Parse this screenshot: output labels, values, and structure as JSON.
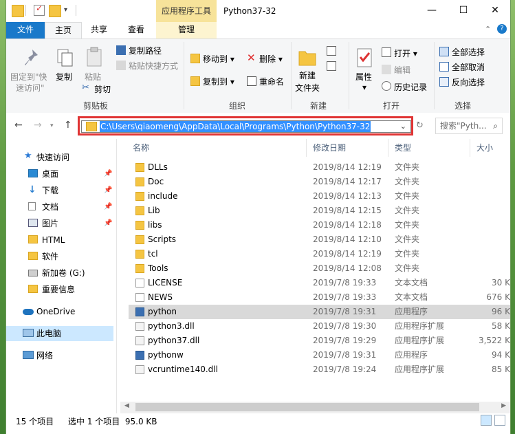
{
  "window": {
    "title": "Python37-32",
    "contextual_tab_group": "应用程序工具",
    "controls": {
      "minimize": "—",
      "maximize": "☐",
      "close": "✕"
    }
  },
  "ribbon_tabs": [
    {
      "label": "文件"
    },
    {
      "label": "主页"
    },
    {
      "label": "共享"
    },
    {
      "label": "查看"
    },
    {
      "label": "管理"
    }
  ],
  "ribbon": {
    "clipboard": {
      "pin_label_1": "固定到\"快",
      "pin_label_2": "速访问\"",
      "copy": "复制",
      "paste": "粘贴",
      "copy_path": "复制路径",
      "paste_shortcut": "粘贴快捷方式",
      "cut": "剪切",
      "group": "剪贴板"
    },
    "organize": {
      "move_to": "移动到",
      "copy_to": "复制到",
      "delete": "删除",
      "rename": "重命名",
      "group": "组织"
    },
    "new": {
      "new_folder_1": "新建",
      "new_folder_2": "文件夹",
      "group": "新建"
    },
    "open": {
      "properties": "属性",
      "open": "打开",
      "edit": "编辑",
      "history": "历史记录",
      "group": "打开"
    },
    "select": {
      "select_all": "全部选择",
      "select_none": "全部取消",
      "invert": "反向选择",
      "group": "选择"
    }
  },
  "address": {
    "path": "C:\\Users\\qiaomeng\\AppData\\Local\\Programs\\Python\\Python37-32",
    "search_placeholder": "搜索\"Pyth..."
  },
  "nav": {
    "items": [
      {
        "label": "快速访问",
        "icon": "star-icon",
        "pinned": false
      },
      {
        "label": "桌面",
        "icon": "desktop-icon",
        "pinned": true
      },
      {
        "label": "下载",
        "icon": "download-icon",
        "pinned": true
      },
      {
        "label": "文档",
        "icon": "document-icon",
        "pinned": true
      },
      {
        "label": "图片",
        "icon": "picture-icon",
        "pinned": true
      },
      {
        "label": "HTML",
        "icon": "folder-icon",
        "pinned": false
      },
      {
        "label": "软件",
        "icon": "folder-icon",
        "pinned": false
      },
      {
        "label": "新加卷 (G:)",
        "icon": "drive-icon",
        "pinned": false
      },
      {
        "label": "重要信息",
        "icon": "folder-icon",
        "pinned": false
      },
      {
        "label": "OneDrive",
        "icon": "cloud-icon",
        "pinned": false
      },
      {
        "label": "此电脑",
        "icon": "computer-icon",
        "pinned": false
      },
      {
        "label": "网络",
        "icon": "network-icon",
        "pinned": false
      }
    ]
  },
  "columns": {
    "name": "名称",
    "date": "修改日期",
    "type": "类型",
    "size": "大小"
  },
  "files": [
    {
      "name": "DLLs",
      "date": "2019/8/14 12:19",
      "type": "文件夹",
      "size": "",
      "kind": "folder"
    },
    {
      "name": "Doc",
      "date": "2019/8/14 12:17",
      "type": "文件夹",
      "size": "",
      "kind": "folder"
    },
    {
      "name": "include",
      "date": "2019/8/14 12:13",
      "type": "文件夹",
      "size": "",
      "kind": "folder"
    },
    {
      "name": "Lib",
      "date": "2019/8/14 12:15",
      "type": "文件夹",
      "size": "",
      "kind": "folder"
    },
    {
      "name": "libs",
      "date": "2019/8/14 12:18",
      "type": "文件夹",
      "size": "",
      "kind": "folder"
    },
    {
      "name": "Scripts",
      "date": "2019/8/14 12:10",
      "type": "文件夹",
      "size": "",
      "kind": "folder"
    },
    {
      "name": "tcl",
      "date": "2019/8/14 12:19",
      "type": "文件夹",
      "size": "",
      "kind": "folder"
    },
    {
      "name": "Tools",
      "date": "2019/8/14 12:08",
      "type": "文件夹",
      "size": "",
      "kind": "folder"
    },
    {
      "name": "LICENSE",
      "date": "2019/7/8 19:33",
      "type": "文本文档",
      "size": "30 K",
      "kind": "doc"
    },
    {
      "name": "NEWS",
      "date": "2019/7/8 19:33",
      "type": "文本文档",
      "size": "676 K",
      "kind": "doc"
    },
    {
      "name": "python",
      "date": "2019/7/8 19:31",
      "type": "应用程序",
      "size": "96 K",
      "kind": "exe"
    },
    {
      "name": "python3.dll",
      "date": "2019/7/8 19:30",
      "type": "应用程序扩展",
      "size": "58 K",
      "kind": "dll"
    },
    {
      "name": "python37.dll",
      "date": "2019/7/8 19:29",
      "type": "应用程序扩展",
      "size": "3,522 K",
      "kind": "dll"
    },
    {
      "name": "pythonw",
      "date": "2019/7/8 19:31",
      "type": "应用程序",
      "size": "94 K",
      "kind": "exe"
    },
    {
      "name": "vcruntime140.dll",
      "date": "2019/7/8 19:24",
      "type": "应用程序扩展",
      "size": "85 K",
      "kind": "dll"
    }
  ],
  "selected_index": 10,
  "status": {
    "count": "15 个项目",
    "selection": "选中 1 个项目  95.0 KB"
  }
}
